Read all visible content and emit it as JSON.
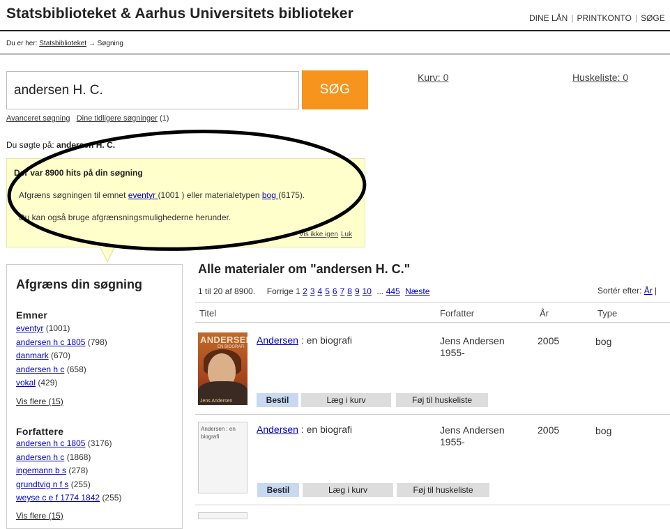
{
  "header": {
    "title": "Statsbiblioteket & Aarhus Universitets biblioteker",
    "nav": [
      "DINE LÅN",
      "PRINTKONTO",
      "SØGE"
    ]
  },
  "breadcrumb": {
    "prefix": "Du er her:",
    "home": "Statsbiblioteket",
    "arrow": "→",
    "current": "Søgning"
  },
  "search": {
    "query": "andersen H. C.",
    "button": "SØG",
    "advanced": "Avanceret søgning",
    "previous": "Dine tidligere søgninger",
    "previous_count": "(1)",
    "searched_label": "Du søgte på:",
    "searched_value": "andersen H. C."
  },
  "account": {
    "basket": "Kurv: 0",
    "memo": "Huskeliste: 0"
  },
  "hits_box": {
    "title": "Der var 8900 hits på din søgning",
    "line1_pre": "Afgræns søgningen til emnet",
    "subject_link": "eventyr ",
    "subject_count": "(1001 ) eller materialetypen",
    "type_link": "bog ",
    "type_count": "(6175).",
    "line2": "Du kan også bruge afgrænsningsmulighederne herunder.",
    "hide": "Vis ikke igen",
    "close": "Luk"
  },
  "sidebar": {
    "title": "Afgræns din søgning",
    "subjects_heading": "Emner",
    "subjects": [
      {
        "label": "eventyr",
        "count": "(1001)"
      },
      {
        "label": "andersen h c 1805",
        "count": "(798)"
      },
      {
        "label": "danmark",
        "count": "(670)"
      },
      {
        "label": "andersen h c",
        "count": "(658)"
      },
      {
        "label": "vokal",
        "count": "(429)"
      }
    ],
    "subjects_more": "Vis flere (15)",
    "authors_heading": "Forfattere",
    "authors": [
      {
        "label": "andersen h c 1805",
        "count": "(3176)"
      },
      {
        "label": "andersen h c",
        "count": "(1868)"
      },
      {
        "label": "ingemann b s",
        "count": "(278)"
      },
      {
        "label": "grundtvig n f s",
        "count": "(255)"
      },
      {
        "label": "weyse c e f 1774 1842",
        "count": "(255)"
      }
    ],
    "authors_more": "Vis flere (15)"
  },
  "results": {
    "title": "Alle materialer om \"andersen H. C.\"",
    "range": "1  til  20 af 8900.",
    "prev": "Forrige",
    "current_page": "1",
    "pages": [
      "2",
      "3",
      "4",
      "5",
      "6",
      "7",
      "8",
      "9",
      "10"
    ],
    "ellipsis": "...",
    "last_page": "445",
    "next": "Næste",
    "sort_label": "Sortér efter:",
    "sort_link": "År",
    "columns": {
      "title": "Titel",
      "author": "Forfatter",
      "year": "År",
      "type": "Type"
    },
    "items": [
      {
        "title_link": "Andersen",
        "title_rest": " : en biografi",
        "author_line1": "Jens Andersen",
        "author_line2": "1955-",
        "year": "2005",
        "type": "bog",
        "cover_title": "ANDERSEN",
        "cover_sub": "EN BIOGRAFI",
        "cover_author": "Jens Andersen"
      },
      {
        "title_link": "Andersen",
        "title_rest": " : en biografi",
        "author_line1": "Jens Andersen",
        "author_line2": "1955-",
        "year": "2005",
        "type": "bog",
        "cover_placeholder": "Andersen : en biografi"
      }
    ],
    "buttons": {
      "order": "Bestil",
      "basket": "Læg i kurv",
      "memo": "Føj til huskeliste"
    }
  },
  "colors": {
    "accent": "#f7941d",
    "notice_bg": "#ffffcc",
    "link": "#0000cc",
    "order_btn": "#c8d9f2"
  }
}
